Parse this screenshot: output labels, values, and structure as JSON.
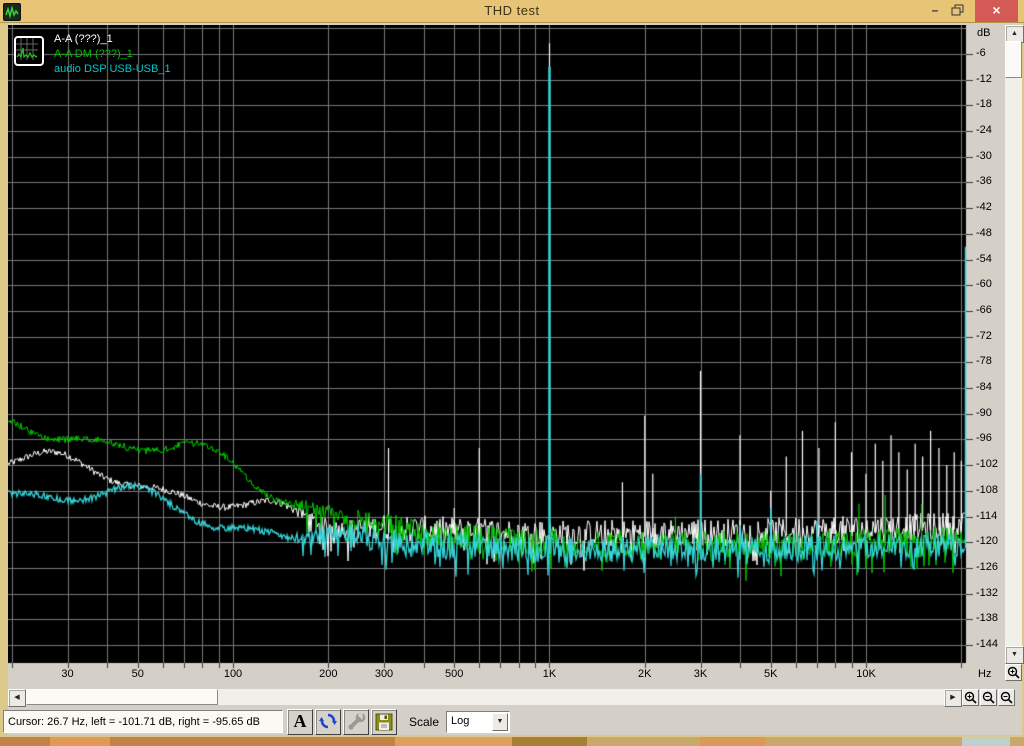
{
  "window": {
    "title": "THD test",
    "minimize_glyph": "–",
    "close_glyph": "×"
  },
  "legend": {
    "items": [
      {
        "label": "A-A (???)_1",
        "color": "#ffffff"
      },
      {
        "label": "A-A DM (???)_1",
        "color": "#00c000"
      },
      {
        "label": "audio DSP USB-USB_1",
        "color": "#00c8c8"
      }
    ]
  },
  "axes": {
    "y_unit": "dB",
    "x_unit": "Hz",
    "y_ticks": [
      "-6",
      "-12",
      "-18",
      "-24",
      "-30",
      "-36",
      "-42",
      "-48",
      "-54",
      "-60",
      "-66",
      "-72",
      "-78",
      "-84",
      "-90",
      "-96",
      "-102",
      "-108",
      "-114",
      "-120",
      "-126",
      "-132",
      "-138",
      "-144"
    ],
    "x_ticks": [
      {
        "label": "30",
        "freq": 30
      },
      {
        "label": "50",
        "freq": 50
      },
      {
        "label": "100",
        "freq": 100
      },
      {
        "label": "200",
        "freq": 200
      },
      {
        "label": "300",
        "freq": 300
      },
      {
        "label": "500",
        "freq": 500
      },
      {
        "label": "1K",
        "freq": 1000
      },
      {
        "label": "2K",
        "freq": 2000
      },
      {
        "label": "3K",
        "freq": 3000
      },
      {
        "label": "5K",
        "freq": 5000
      },
      {
        "label": "10K",
        "freq": 10000
      }
    ]
  },
  "icons": {
    "up_arrow": "▲",
    "down_arrow": "▼",
    "left_arrow": "◀",
    "right_arrow": "▶",
    "drop_arrow": "▼"
  },
  "toolbar": {
    "font_button_label": "A",
    "scale_label": "Scale",
    "scale_value": "Log"
  },
  "statusbar": {
    "cursor_text": "Cursor:  26.7 Hz,  left = -101.71 dB,  right = -95.65 dB"
  },
  "chart_data": {
    "type": "line",
    "title": "THD test spectrum",
    "x_scale": "log",
    "xlabel": "Hz",
    "ylabel": "dB",
    "x_range_hz": [
      19.5,
      21800
    ],
    "y_range_db": [
      0,
      -148
    ],
    "y_grid_step_db": 6,
    "x_grid_lines_hz": [
      20,
      30,
      40,
      50,
      60,
      70,
      80,
      90,
      100,
      200,
      300,
      400,
      500,
      600,
      700,
      800,
      900,
      1000,
      2000,
      3000,
      4000,
      5000,
      6000,
      7000,
      8000,
      9000,
      10000,
      20000
    ],
    "grid_color": "#787878",
    "background": "#000000",
    "series": [
      {
        "name": "A-A (???)_1",
        "color": "#ffffff",
        "noise_db": 3.2,
        "envelope_db": [
          [
            19.5,
            -100.5
          ],
          [
            30,
            -103
          ],
          [
            50,
            -105.5
          ],
          [
            70,
            -108
          ],
          [
            90,
            -110
          ],
          [
            120,
            -113
          ],
          [
            160,
            -115
          ],
          [
            220,
            -116
          ],
          [
            400,
            -117
          ],
          [
            1000,
            -118
          ],
          [
            6000,
            -117.5
          ],
          [
            21000,
            -116
          ]
        ],
        "spikes_hz_db": [
          [
            310,
            -98
          ],
          [
            500,
            -112
          ],
          [
            600,
            -98
          ],
          [
            1000,
            -3.5
          ],
          [
            1700,
            -106
          ],
          [
            2000,
            -90.5
          ],
          [
            2120,
            -104
          ],
          [
            3000,
            -80
          ],
          [
            4000,
            -95
          ],
          [
            5000,
            -108
          ],
          [
            5600,
            -100
          ],
          [
            6300,
            -94
          ],
          [
            7100,
            -98
          ],
          [
            8000,
            -92
          ],
          [
            9000,
            -99
          ],
          [
            10000,
            -104
          ],
          [
            10700,
            -97
          ],
          [
            11300,
            -101
          ],
          [
            12000,
            -95
          ],
          [
            12700,
            -99
          ],
          [
            13500,
            -103
          ],
          [
            14300,
            -97
          ],
          [
            15100,
            -100
          ],
          [
            16000,
            -94
          ],
          [
            17000,
            -98
          ],
          [
            18000,
            -102
          ],
          [
            19000,
            -99
          ],
          [
            20000,
            -101
          ]
        ]
      },
      {
        "name": "A-A DM (???)_1",
        "color": "#00c800",
        "noise_db": 3.2,
        "envelope_db": [
          [
            19.5,
            -93.5
          ],
          [
            30,
            -94.5
          ],
          [
            50,
            -96.5
          ],
          [
            70,
            -99
          ],
          [
            90,
            -102
          ],
          [
            110,
            -105
          ],
          [
            130,
            -107.5
          ],
          [
            160,
            -110
          ],
          [
            200,
            -112.5
          ],
          [
            250,
            -114.5
          ],
          [
            320,
            -116.5
          ],
          [
            450,
            -118.5
          ],
          [
            700,
            -119.5
          ],
          [
            1500,
            -120.5
          ],
          [
            6000,
            -120.5
          ],
          [
            21000,
            -119.5
          ]
        ],
        "spikes_hz_db": [
          [
            2500,
            -114
          ],
          [
            9500,
            -111
          ],
          [
            11500,
            -109
          ],
          [
            15000,
            -111
          ]
        ]
      },
      {
        "name": "audio DSP USB-USB_1",
        "color": "#35d4d8",
        "noise_db": 3.0,
        "envelope_db": [
          [
            19.5,
            -107.5
          ],
          [
            30,
            -108.5
          ],
          [
            50,
            -110.5
          ],
          [
            70,
            -112.5
          ],
          [
            90,
            -114.5
          ],
          [
            120,
            -116.5
          ],
          [
            160,
            -118
          ],
          [
            220,
            -119
          ],
          [
            350,
            -120.5
          ],
          [
            700,
            -121.5
          ],
          [
            1500,
            -122
          ],
          [
            6000,
            -121.5
          ],
          [
            21000,
            -120.5
          ]
        ],
        "spikes_hz_db": [
          [
            1000,
            -9
          ],
          [
            3000,
            -104
          ],
          [
            4000,
            -116
          ],
          [
            5000,
            -112
          ],
          [
            7000,
            -115
          ],
          [
            20900,
            -51
          ]
        ]
      }
    ]
  }
}
